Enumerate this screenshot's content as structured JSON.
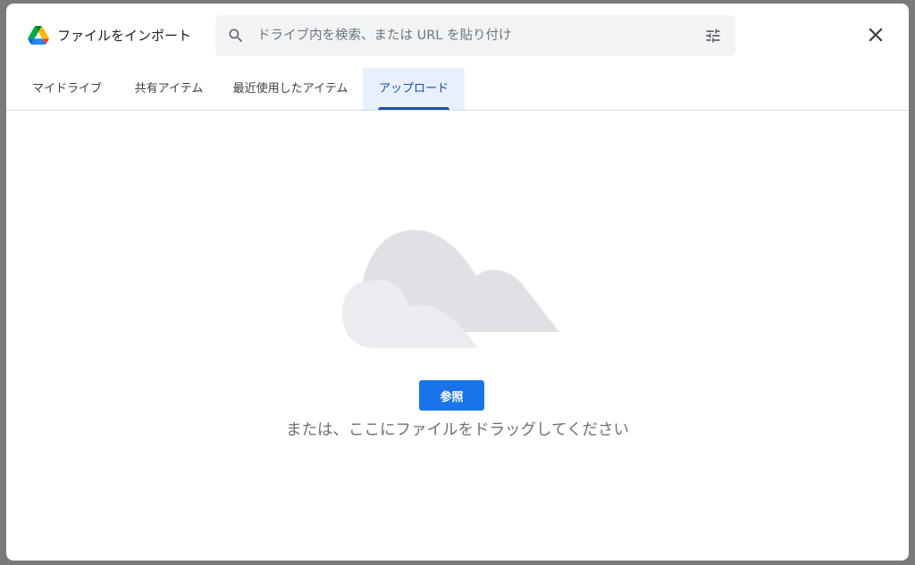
{
  "dialog": {
    "title": "ファイルをインポート",
    "close_label": "close"
  },
  "search": {
    "placeholder": "ドライブ内を検索、または URL を貼り付け",
    "value": ""
  },
  "tabs": [
    {
      "label": "マイドライブ",
      "active": false
    },
    {
      "label": "共有アイテム",
      "active": false
    },
    {
      "label": "最近使用したアイテム",
      "active": false
    },
    {
      "label": "アップロード",
      "active": true
    }
  ],
  "upload": {
    "browse_label": "参照",
    "drag_hint": "または、ここにファイルをドラッグしてください"
  },
  "icons": {
    "logo": "google-drive-logo",
    "search": "search-icon",
    "tune": "tune-icon",
    "close": "close-icon",
    "cloud": "cloud-illustration"
  },
  "colors": {
    "accent": "#1a73e8",
    "active_tab_bg": "#e8f0fe",
    "active_tab_text": "#174ea6",
    "search_bg": "#f1f3f4"
  }
}
